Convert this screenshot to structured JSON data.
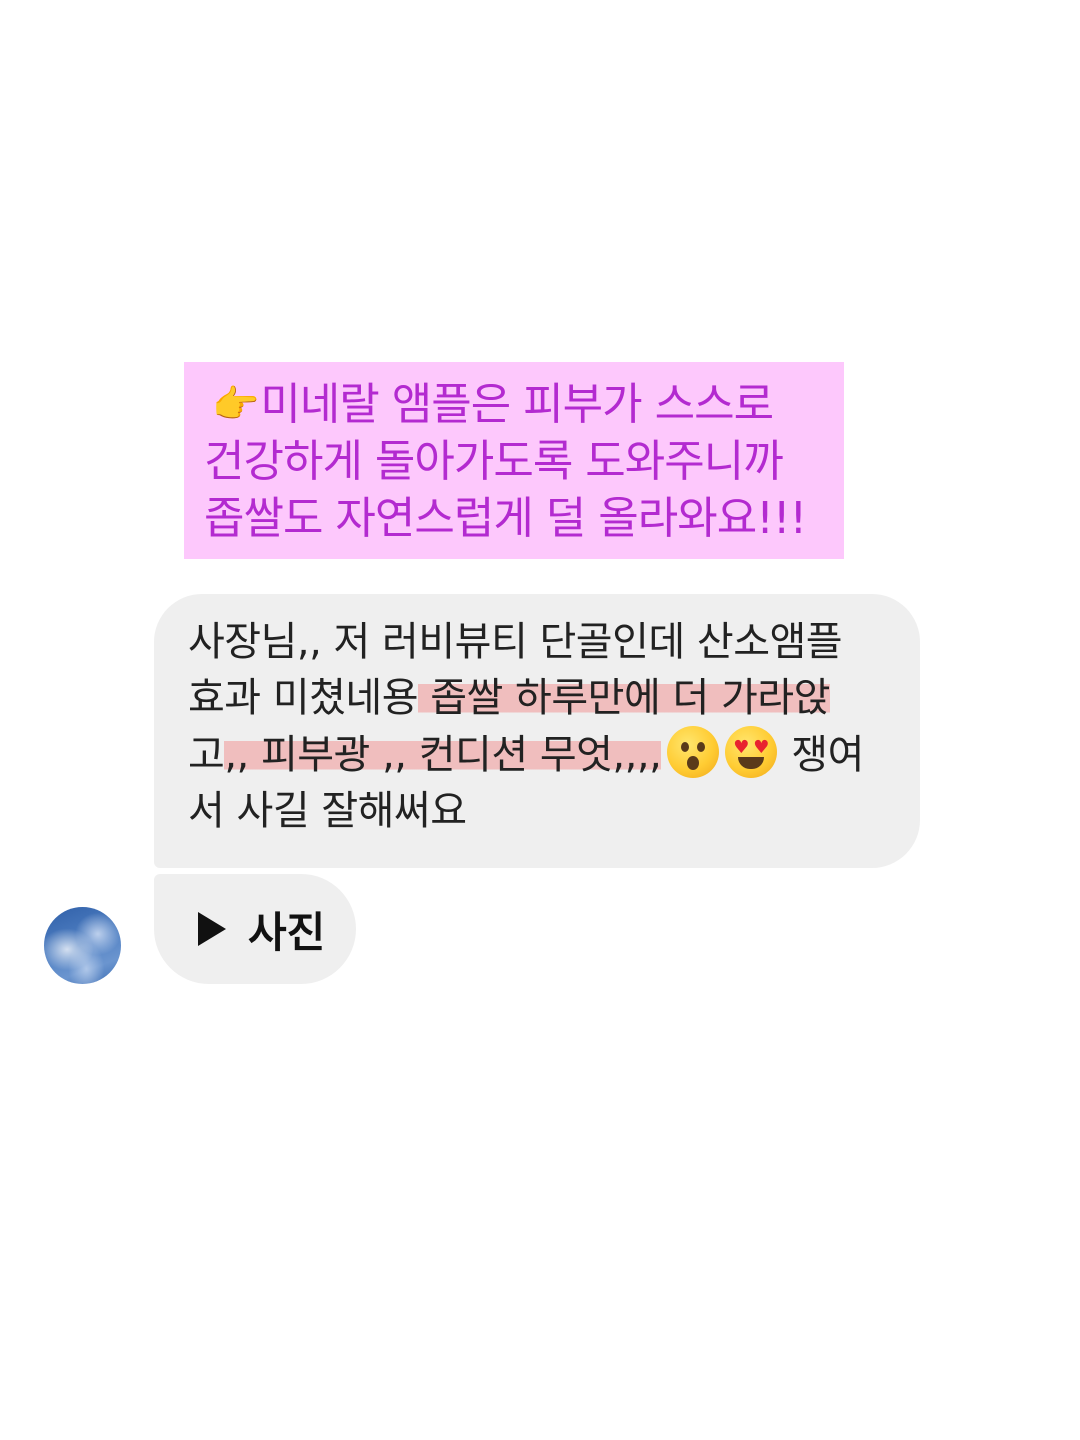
{
  "caption": {
    "icon": "pointing-hand-emoji",
    "line1": "미네랄 앰플은 피부가 스스로",
    "line2": "건강하게 돌아가도록 도와주니까",
    "line3": "좁쌀도 자연스럽게 덜 올라와요!!!",
    "background": "#fdc8fc",
    "text_color": "#b32ad0"
  },
  "message": {
    "line1": "사장님,, 저 러비뷰티 단골인데 산소앰플",
    "line2_plain": "효과 미쳤네용",
    "line2_highlight": " 좁쌀 하루만에 더 가라앉",
    "line3_plain": "고",
    "line3_highlight": ",, 피부광 ,, 컨디션 무엇,,,,",
    "line3_emojis": [
      "hushed-face-emoji",
      "heart-eyes-emoji"
    ],
    "line3_tail": "쟁여",
    "line4": "서 사길 잘해써요",
    "highlight_color": "#f09696"
  },
  "media": {
    "icon": "play-icon",
    "label": "사진"
  },
  "avatar": {
    "description_icon": "sky-avatar"
  }
}
